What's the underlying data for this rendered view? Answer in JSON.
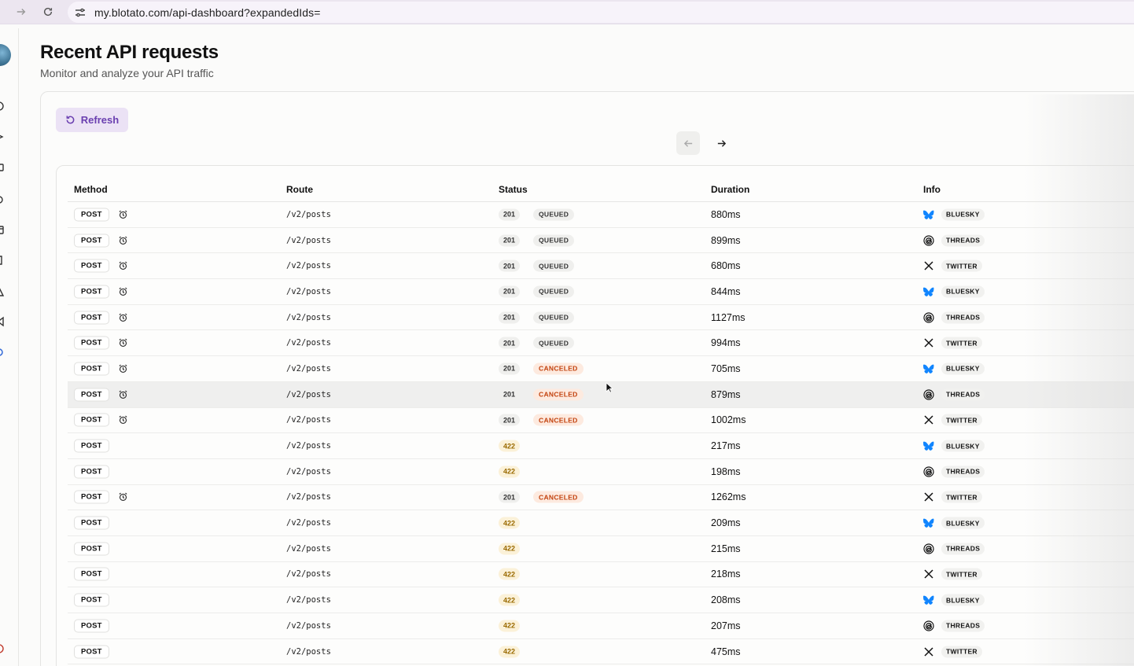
{
  "browser": {
    "url": "my.blotato.com/api-dashboard?expandedIds="
  },
  "page": {
    "title": "Recent API requests",
    "subtitle": "Monitor and analyze your API traffic"
  },
  "toolbar": {
    "refresh_label": "Refresh"
  },
  "table": {
    "headers": {
      "method": "Method",
      "route": "Route",
      "status": "Status",
      "duration": "Duration",
      "info": "Info"
    },
    "rows": [
      {
        "method": "POST",
        "scheduled": true,
        "route": "/v2/posts",
        "code": "201",
        "state": "QUEUED",
        "duration": "880ms",
        "platform": "BLUESKY"
      },
      {
        "method": "POST",
        "scheduled": true,
        "route": "/v2/posts",
        "code": "201",
        "state": "QUEUED",
        "duration": "899ms",
        "platform": "THREADS"
      },
      {
        "method": "POST",
        "scheduled": true,
        "route": "/v2/posts",
        "code": "201",
        "state": "QUEUED",
        "duration": "680ms",
        "platform": "TWITTER"
      },
      {
        "method": "POST",
        "scheduled": true,
        "route": "/v2/posts",
        "code": "201",
        "state": "QUEUED",
        "duration": "844ms",
        "platform": "BLUESKY"
      },
      {
        "method": "POST",
        "scheduled": true,
        "route": "/v2/posts",
        "code": "201",
        "state": "QUEUED",
        "duration": "1127ms",
        "platform": "THREADS"
      },
      {
        "method": "POST",
        "scheduled": true,
        "route": "/v2/posts",
        "code": "201",
        "state": "QUEUED",
        "duration": "994ms",
        "platform": "TWITTER"
      },
      {
        "method": "POST",
        "scheduled": true,
        "route": "/v2/posts",
        "code": "201",
        "state": "CANCELED",
        "duration": "705ms",
        "platform": "BLUESKY"
      },
      {
        "method": "POST",
        "scheduled": true,
        "route": "/v2/posts",
        "code": "201",
        "state": "CANCELED",
        "duration": "879ms",
        "platform": "THREADS"
      },
      {
        "method": "POST",
        "scheduled": true,
        "route": "/v2/posts",
        "code": "201",
        "state": "CANCELED",
        "duration": "1002ms",
        "platform": "TWITTER"
      },
      {
        "method": "POST",
        "scheduled": false,
        "route": "/v2/posts",
        "code": "422",
        "state": "",
        "duration": "217ms",
        "platform": "BLUESKY"
      },
      {
        "method": "POST",
        "scheduled": false,
        "route": "/v2/posts",
        "code": "422",
        "state": "",
        "duration": "198ms",
        "platform": "THREADS"
      },
      {
        "method": "POST",
        "scheduled": true,
        "route": "/v2/posts",
        "code": "201",
        "state": "CANCELED",
        "duration": "1262ms",
        "platform": "TWITTER"
      },
      {
        "method": "POST",
        "scheduled": false,
        "route": "/v2/posts",
        "code": "422",
        "state": "",
        "duration": "209ms",
        "platform": "BLUESKY"
      },
      {
        "method": "POST",
        "scheduled": false,
        "route": "/v2/posts",
        "code": "422",
        "state": "",
        "duration": "215ms",
        "platform": "THREADS"
      },
      {
        "method": "POST",
        "scheduled": false,
        "route": "/v2/posts",
        "code": "422",
        "state": "",
        "duration": "218ms",
        "platform": "TWITTER"
      },
      {
        "method": "POST",
        "scheduled": false,
        "route": "/v2/posts",
        "code": "422",
        "state": "",
        "duration": "208ms",
        "platform": "BLUESKY"
      },
      {
        "method": "POST",
        "scheduled": false,
        "route": "/v2/posts",
        "code": "422",
        "state": "",
        "duration": "207ms",
        "platform": "THREADS"
      },
      {
        "method": "POST",
        "scheduled": false,
        "route": "/v2/posts",
        "code": "422",
        "state": "",
        "duration": "475ms",
        "platform": "TWITTER"
      }
    ]
  },
  "colors": {
    "accent": "#6a3fb0",
    "accent_bg": "#ebe2f5",
    "canceled": "#c2410c",
    "error_code": "#9a6a00",
    "bluesky": "#1185fe"
  }
}
